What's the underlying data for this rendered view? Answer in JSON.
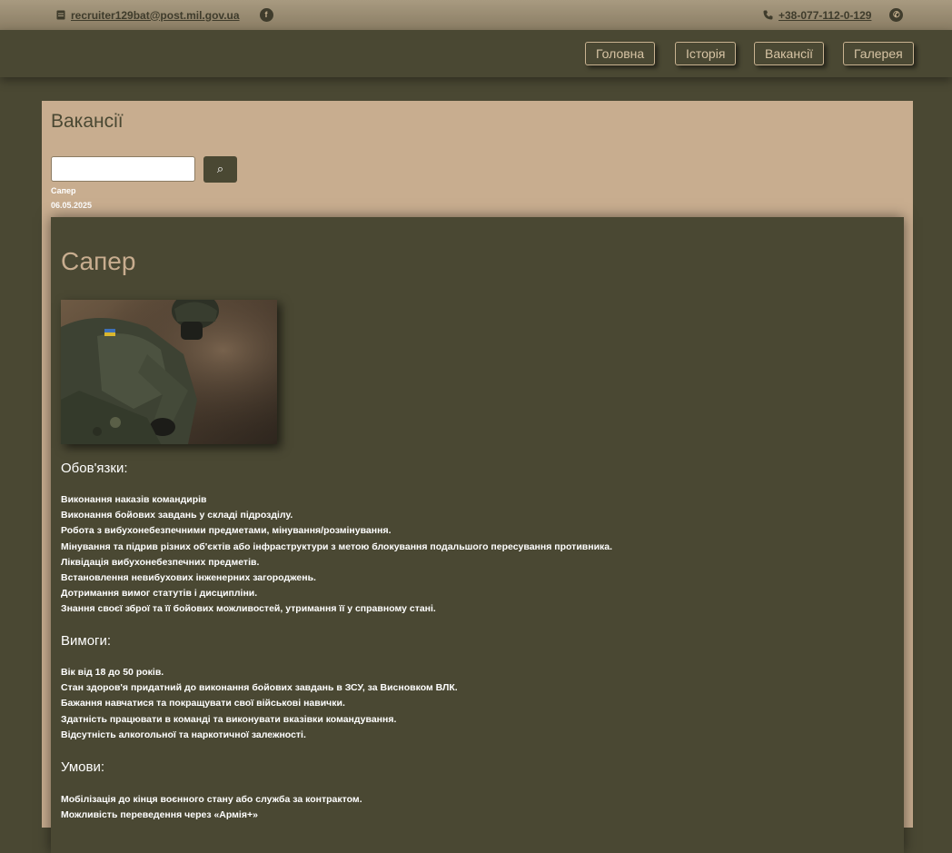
{
  "topbar": {
    "email": "recruiter129bat@post.mil.gov.ua",
    "phone": "+38-077-112-0-129",
    "email_icon": "mail-icon",
    "facebook_icon": "facebook-icon",
    "phone_icon": "phone-icon",
    "whatsapp_icon": "whatsapp-icon"
  },
  "nav": {
    "home": "Головна",
    "history": "Історія",
    "vacancies": "Вакансії",
    "gallery": "Галерея"
  },
  "page": {
    "title": "Вакансії",
    "search_placeholder": "",
    "search_icon": "⌕",
    "vacancy_link": "Сапер",
    "vacancy_date": "06.05.2025"
  },
  "article": {
    "title": "Сапер",
    "duties_heading": "Обов'язки:",
    "duties": [
      "Виконання наказів командирів",
      "Виконання бойових завдань у складі підрозділу.",
      "Робота з вибухонебезпечними предметами, мінування/розмінування.",
      "Мінування та підрив різних об'єктів або інфраструктури з метою блокування подальшого пересування противника.",
      "Ліквідація вибухонебезпечних предметів.",
      "Встановлення невибухових інженерних загороджень.",
      "Дотримання вимог статутів і дисципліни.",
      "Знання своєї зброї та її бойових можливостей, утримання її у справному стані."
    ],
    "requirements_heading": "Вимоги:",
    "requirements": [
      "Вік від 18 до 50 років.",
      "Стан здоров'я придатний до виконання бойових завдань в ЗСУ, за Висновком ВЛК.",
      "Бажання навчатися та покращувати свої військові навички.",
      "Здатність працювати в команді та виконувати вказівки командування.",
      "Відсутність алкогольної та наркотичної залежності."
    ],
    "conditions_heading": "Умови:",
    "conditions": [
      "Мобілізація до кінця воєнного стану або служба за контрактом.",
      "Можливість переведення через «Армія+»"
    ]
  }
}
